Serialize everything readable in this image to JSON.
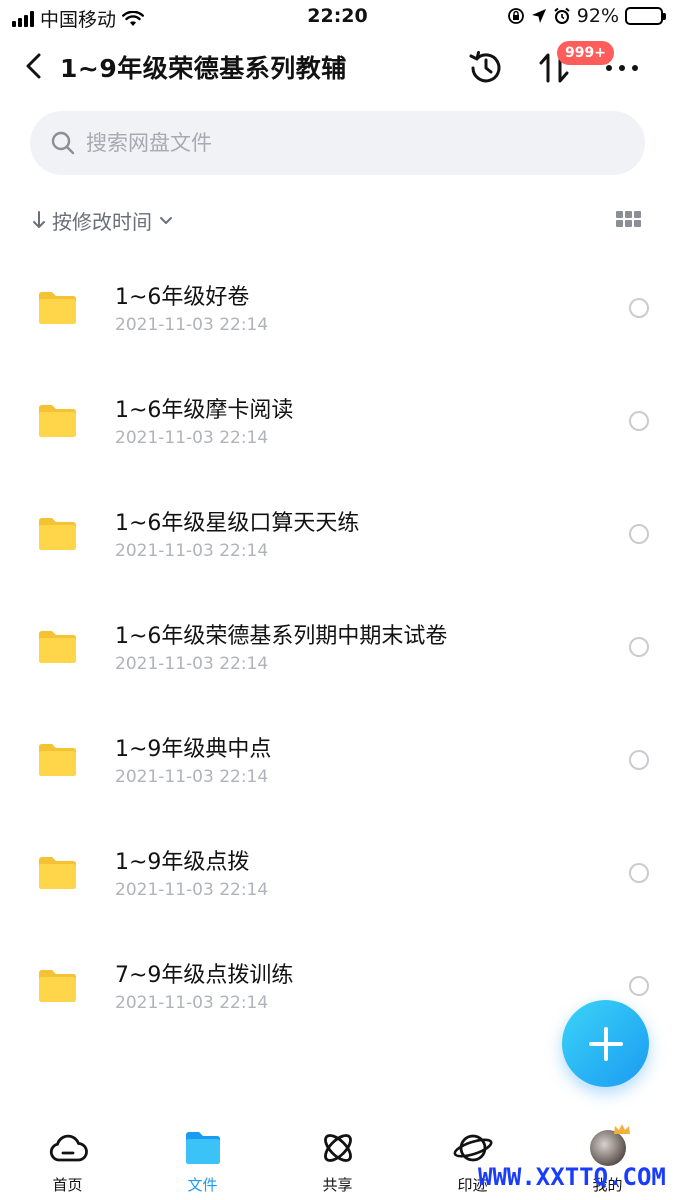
{
  "status_bar": {
    "carrier": "中国移动",
    "time": "22:20",
    "battery": "92%",
    "battery_level": 0.92
  },
  "nav": {
    "title": "1~9年级荣德基系列教辅",
    "transfer_badge": "999+"
  },
  "search": {
    "placeholder": "搜索网盘文件",
    "value": ""
  },
  "sort": {
    "label": "按修改时间"
  },
  "files": [
    {
      "name": "1~6年级好卷",
      "time": "2021-11-03 22:14"
    },
    {
      "name": "1~6年级摩卡阅读",
      "time": "2021-11-03 22:14"
    },
    {
      "name": "1~6年级星级口算天天练",
      "time": "2021-11-03 22:14"
    },
    {
      "name": "1~6年级荣德基系列期中期末试卷",
      "time": "2021-11-03 22:14"
    },
    {
      "name": "1~9年级典中点",
      "time": "2021-11-03 22:14"
    },
    {
      "name": "1~9年级点拨",
      "time": "2021-11-03 22:14"
    },
    {
      "name": "7~9年级点拨训练",
      "time": "2021-11-03 22:14"
    }
  ],
  "tabs": [
    {
      "label": "首页",
      "icon": "cloud-icon"
    },
    {
      "label": "文件",
      "icon": "folder-icon"
    },
    {
      "label": "共享",
      "icon": "orbit-icon"
    },
    {
      "label": "印迹",
      "icon": "planet-icon"
    },
    {
      "label": "我的",
      "icon": "avatar"
    }
  ],
  "watermark": "WWW.XXTTQ.COM",
  "colors": {
    "accent": "#1a9bf2",
    "folder": "#ffd54a",
    "badge": "#ff5c5c",
    "watermark": "#1a3dfb"
  }
}
